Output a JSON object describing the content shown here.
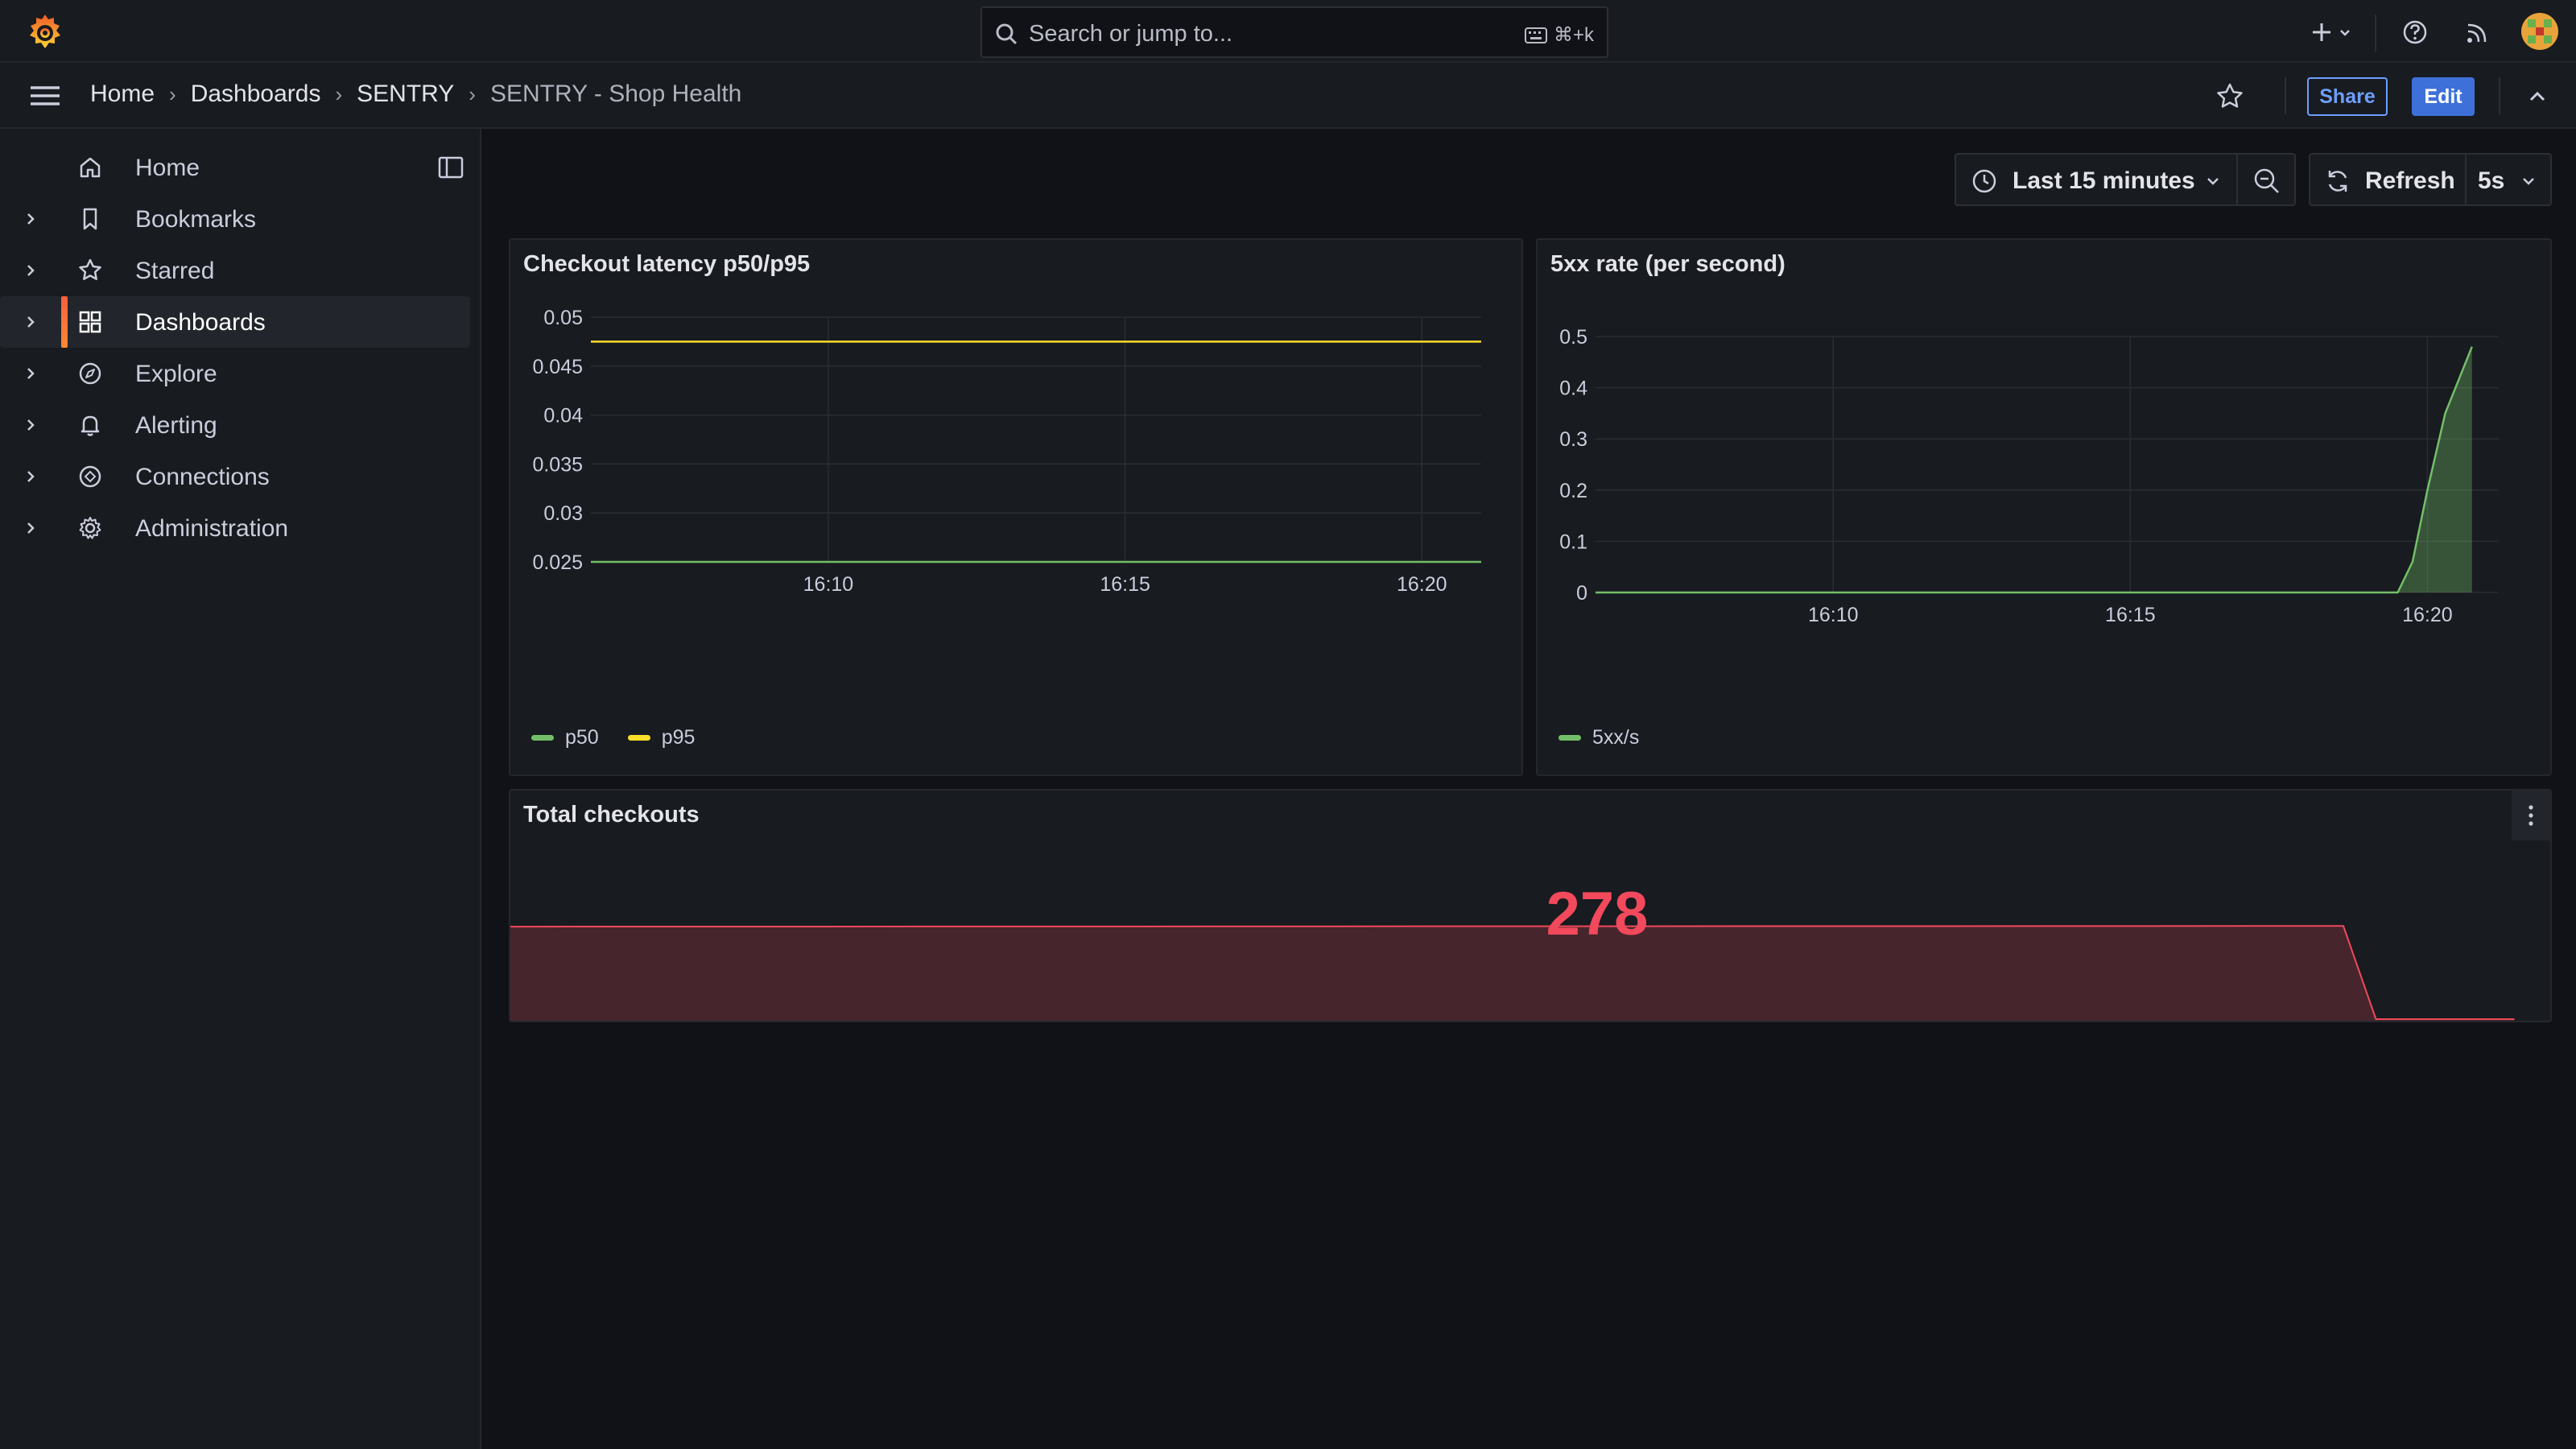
{
  "topbar": {
    "search_placeholder": "Search or jump to...",
    "search_shortcut": "⌘+k",
    "icons": [
      "grafana-logo-icon",
      "search-icon",
      "keyboard-icon",
      "plus-icon",
      "help-icon",
      "news-rss-icon",
      "user-avatar"
    ]
  },
  "breadcrumb": {
    "items": [
      "Home",
      "Dashboards",
      "SENTRY",
      "SENTRY - Shop Health"
    ]
  },
  "actions": {
    "share": "Share",
    "edit": "Edit"
  },
  "sidebar": {
    "items": [
      {
        "label": "Home",
        "icon": "home-icon",
        "expandable": false,
        "active": false
      },
      {
        "label": "Bookmarks",
        "icon": "bookmark-icon",
        "expandable": true,
        "active": false
      },
      {
        "label": "Starred",
        "icon": "star-icon",
        "expandable": true,
        "active": false
      },
      {
        "label": "Dashboards",
        "icon": "apps-icon",
        "expandable": true,
        "active": true
      },
      {
        "label": "Explore",
        "icon": "compass-icon",
        "expandable": true,
        "active": false
      },
      {
        "label": "Alerting",
        "icon": "bell-icon",
        "expandable": true,
        "active": false
      },
      {
        "label": "Connections",
        "icon": "connections-icon",
        "expandable": true,
        "active": false
      },
      {
        "label": "Administration",
        "icon": "cog-icon",
        "expandable": true,
        "active": false
      }
    ]
  },
  "toolbar": {
    "time_range": "Last 15 minutes",
    "refresh": "Refresh",
    "refresh_interval": "5s"
  },
  "colors": {
    "p50": "#73bf69",
    "p95": "#fade2a",
    "5xx": "#73bf69",
    "stat": "#f2495c",
    "accent": "#3d71d9"
  },
  "panels": {
    "latency": {
      "title": "Checkout latency p50/p95",
      "legend": [
        "p50",
        "p95"
      ]
    },
    "errors": {
      "title": "5xx rate (per second)",
      "legend": [
        "5xx/s"
      ]
    },
    "checkouts": {
      "title": "Total checkouts",
      "value": "278"
    }
  },
  "chart_data": [
    {
      "type": "line",
      "title": "Checkout latency p50/p95",
      "x_ticks": [
        "16:10",
        "16:15",
        "16:20"
      ],
      "y_ticks": [
        "0.05",
        "0.045",
        "0.04",
        "0.035",
        "0.03",
        "0.025"
      ],
      "ylim": [
        0.025,
        0.05
      ],
      "xlim_minutes": [
        6.0,
        21.0
      ],
      "x_tick_minutes": [
        10,
        15,
        20
      ],
      "series": [
        {
          "name": "p50",
          "color": "#73bf69",
          "points": [
            [
              6.0,
              0.025
            ],
            [
              21.0,
              0.025
            ]
          ]
        },
        {
          "name": "p95",
          "color": "#fade2a",
          "points": [
            [
              6.0,
              0.0475
            ],
            [
              21.0,
              0.0475
            ]
          ]
        }
      ],
      "grid": true,
      "legend": "bottom-left"
    },
    {
      "type": "area",
      "title": "5xx rate (per second)",
      "x_ticks": [
        "16:10",
        "16:15",
        "16:20"
      ],
      "y_ticks": [
        "0.5",
        "0.4",
        "0.3",
        "0.2",
        "0.1",
        "0"
      ],
      "ylim": [
        0,
        0.5
      ],
      "xlim_minutes": [
        6.0,
        21.2
      ],
      "x_tick_minutes": [
        10,
        15,
        20
      ],
      "series": [
        {
          "name": "5xx/s",
          "color": "#73bf69",
          "points": [
            [
              6.0,
              0
            ],
            [
              19.5,
              0
            ],
            [
              19.75,
              0.06
            ],
            [
              20.0,
              0.2
            ],
            [
              20.3,
              0.35
            ],
            [
              20.75,
              0.48
            ]
          ]
        }
      ],
      "grid": true,
      "legend": "bottom-left"
    },
    {
      "type": "area",
      "title": "Total checkouts",
      "value": "278",
      "color": "#f2495c",
      "ylim": [
        0,
        300
      ],
      "xlim_index": [
        0,
        100
      ],
      "series": [
        {
          "name": "",
          "points": [
            [
              0,
              278
            ],
            [
              90,
              280
            ],
            [
              91.6,
              0
            ],
            [
              98.4,
              0
            ]
          ]
        }
      ]
    }
  ]
}
